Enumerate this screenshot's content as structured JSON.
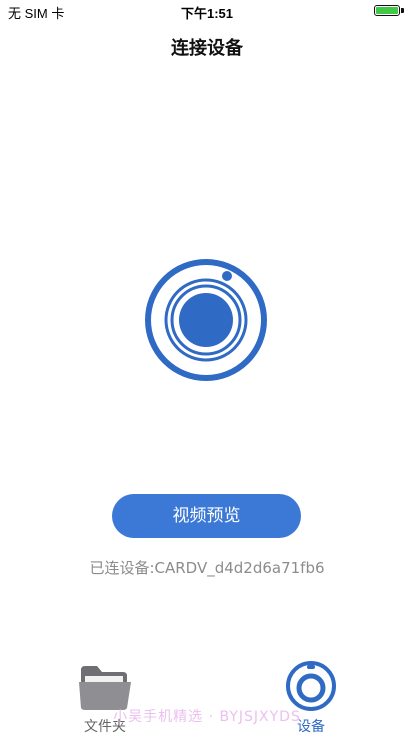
{
  "status_bar": {
    "carrier": "无 SIM 卡",
    "time": "下午1:51",
    "battery_color": "#3fc944"
  },
  "nav": {
    "title": "连接设备"
  },
  "hero": {
    "icon": "camera-lens-icon",
    "color": "#2f6ac5"
  },
  "preview_button": {
    "label": "视频预览",
    "color": "#3c79d6"
  },
  "device": {
    "status_text": "已连设备:CARDV_d4d2d6a71fb6"
  },
  "tabbar": {
    "tabs": [
      {
        "label": "文件夹",
        "icon": "folder-icon",
        "active": false
      },
      {
        "label": "设备",
        "icon": "camera-icon",
        "active": true
      }
    ]
  },
  "watermark": {
    "text": "小吴手机精选 · BYJSJXYDS"
  }
}
